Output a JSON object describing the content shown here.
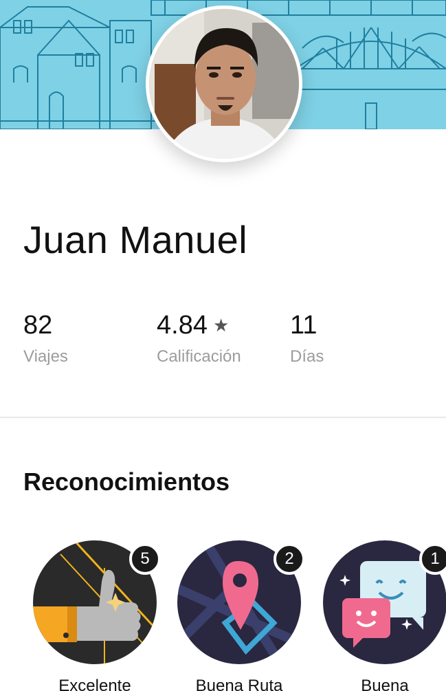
{
  "profile": {
    "name": "Juan Manuel"
  },
  "stats": {
    "trips": {
      "value": "82",
      "label": "Viajes"
    },
    "rating": {
      "value": "4.84",
      "label": "Calificación"
    },
    "days": {
      "value": "11",
      "label": "Días"
    }
  },
  "recognitions": {
    "title": "Reconocimientos",
    "items": [
      {
        "label": "Excelente",
        "count": "5",
        "icon": "thumbs-up-icon"
      },
      {
        "label": "Buena Ruta",
        "count": "2",
        "icon": "map-pin-route-icon"
      },
      {
        "label": "Buena",
        "count": "1",
        "icon": "chat-smiley-icon"
      }
    ]
  },
  "colors": {
    "banner": "#7fd1e6",
    "badge_bg": "#2a2740",
    "pin": "#f06a8f",
    "count_bg": "#1a1a1a"
  }
}
